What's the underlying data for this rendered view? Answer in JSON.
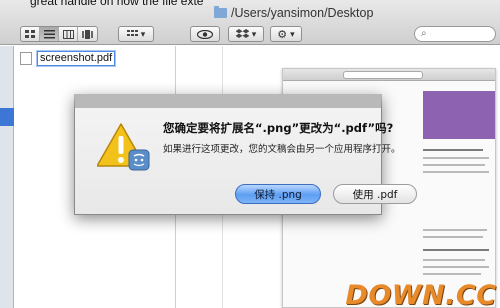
{
  "finder": {
    "cutoff_text": "great handle on how the file exte",
    "window_title": "/Users/yansimon/Desktop",
    "file_name": "screenshot.pdf"
  },
  "icons": {
    "view_buttons": [
      "icon-view-icon",
      "list-view-icon",
      "column-view-icon",
      "coverflow-view-icon"
    ],
    "folder": "folder-icon",
    "quicklook": "eye-icon",
    "dropbox": "dropbox-icon",
    "action": "gear-icon",
    "search": "search-icon",
    "alert": "warning-triangle-icon"
  },
  "dialog": {
    "title": "您确定要将扩展名“.png”更改为“.pdf”吗?",
    "message": "如果进行这项更改，您的文稿会由另一个应用程序打开。",
    "keep_button": "保持 .png",
    "use_button": "使用 .pdf"
  },
  "watermark": "DOWN.CC",
  "colors": {
    "accent_blue": "#3d77d5",
    "default_button": "#5d9ef3",
    "watermark": "#e98a2a",
    "alert_yellow": "#f2c21b"
  }
}
